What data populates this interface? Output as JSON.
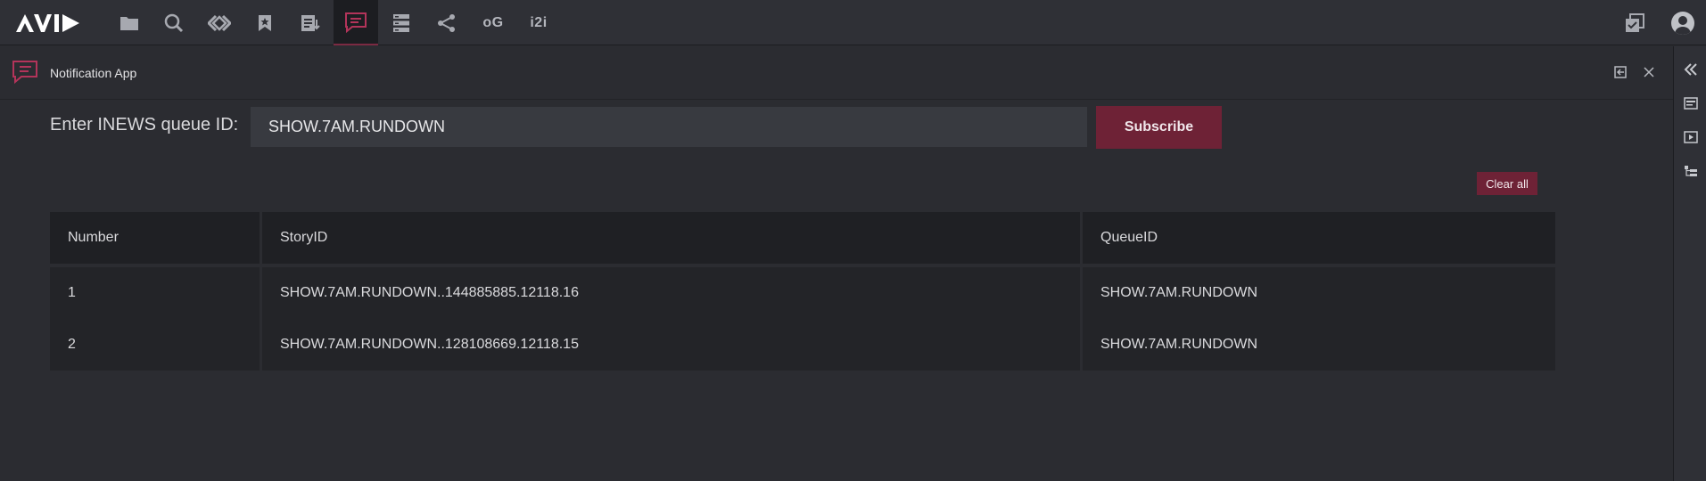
{
  "topbar": {
    "logo_text": "AVID",
    "icons": [
      {
        "name": "folder-icon"
      },
      {
        "name": "search-icon"
      },
      {
        "name": "link-icon"
      },
      {
        "name": "bookmark-icon"
      },
      {
        "name": "rundown-icon"
      },
      {
        "name": "notification-chat-icon",
        "active": true
      },
      {
        "name": "server-icon"
      },
      {
        "name": "share-icon"
      }
    ],
    "og_label": "oG",
    "i2i_label": "i2i"
  },
  "panel": {
    "title": "Notification App"
  },
  "form": {
    "label": "Enter INEWS queue ID:",
    "queue_value": "SHOW.7AM.RUNDOWN",
    "subscribe_label": "Subscribe",
    "clear_label": "Clear all"
  },
  "table": {
    "headers": [
      "Number",
      "StoryID",
      "QueueID"
    ],
    "rows": [
      [
        "1",
        "SHOW.7AM.RUNDOWN..144885885.12118.16",
        "SHOW.7AM.RUNDOWN"
      ],
      [
        "2",
        "SHOW.7AM.RUNDOWN..128108669.12118.15",
        "SHOW.7AM.RUNDOWN"
      ]
    ]
  },
  "colors": {
    "accent": "#6e2236",
    "background": "#2b2c31",
    "topbar": "#2f3036"
  }
}
